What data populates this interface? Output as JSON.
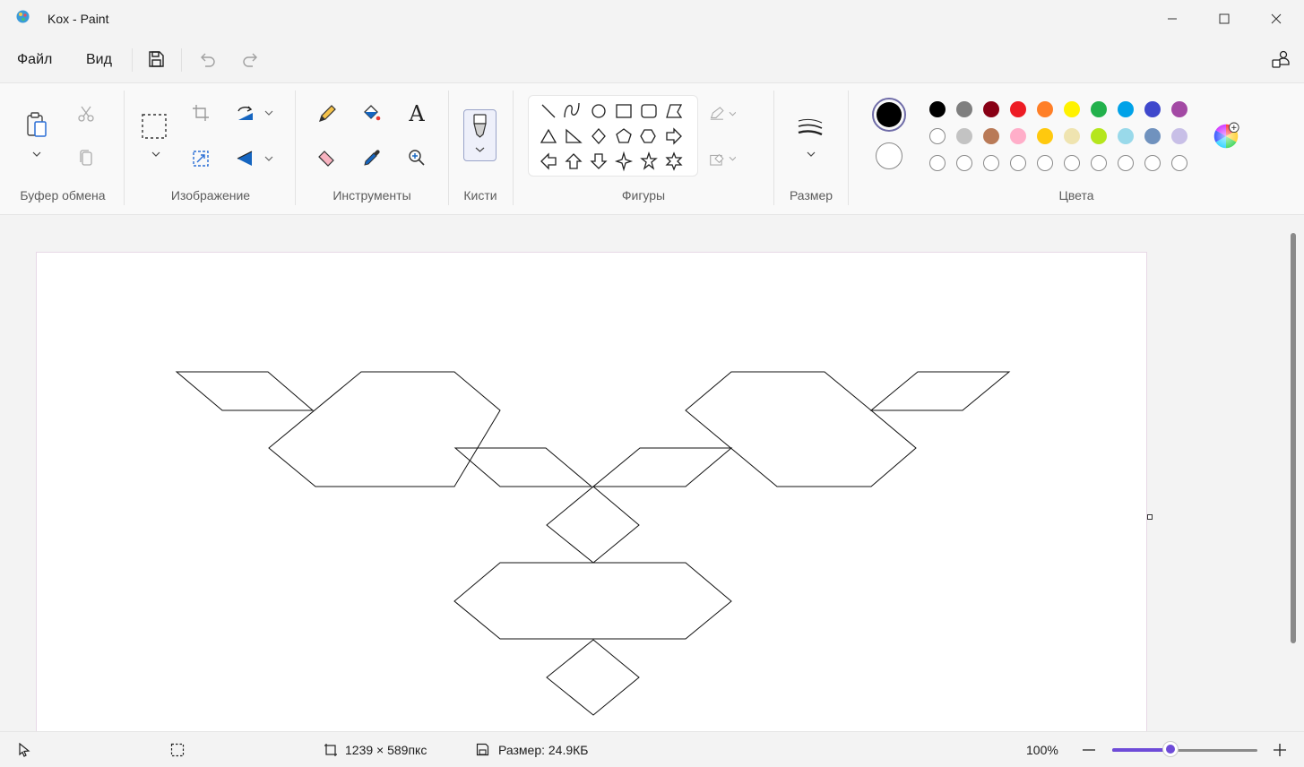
{
  "window": {
    "title": "Kox - Paint"
  },
  "menu": {
    "file": "Файл",
    "view": "Вид"
  },
  "ribbon": {
    "groups": {
      "clipboard": "Буфер обмена",
      "image": "Изображение",
      "tools": "Инструменты",
      "brushes": "Кисти",
      "shapes": "Фигуры",
      "size": "Размер",
      "colors": "Цвета"
    },
    "tools": {
      "text_glyph": "A"
    }
  },
  "colors": {
    "primary": "#000000",
    "secondary": "#ffffff",
    "accent": "#6e4bd8",
    "palette_row1": [
      "#000000",
      "#7f7f7f",
      "#880015",
      "#ed1c24",
      "#ff7f27",
      "#fff200",
      "#22b14c",
      "#00a2e8",
      "#3f48cc",
      "#a349a4"
    ],
    "palette_row2": [
      "#ffffff",
      "#c3c3c3",
      "#b97a57",
      "#ffaec9",
      "#ffc90e",
      "#efe4b0",
      "#b5e61d",
      "#99d9ea",
      "#7092be",
      "#c8bfe7"
    ],
    "palette_row3": [
      "#ffffff",
      "#ffffff",
      "#ffffff",
      "#ffffff",
      "#ffffff",
      "#ffffff",
      "#ffffff",
      "#ffffff",
      "#ffffff",
      "#ffffff"
    ]
  },
  "status": {
    "canvas_size": "1239 × 589пкс",
    "file_size": "Размер: 24.9КБ",
    "zoom": "100%",
    "zoom_fraction": 0.4
  }
}
